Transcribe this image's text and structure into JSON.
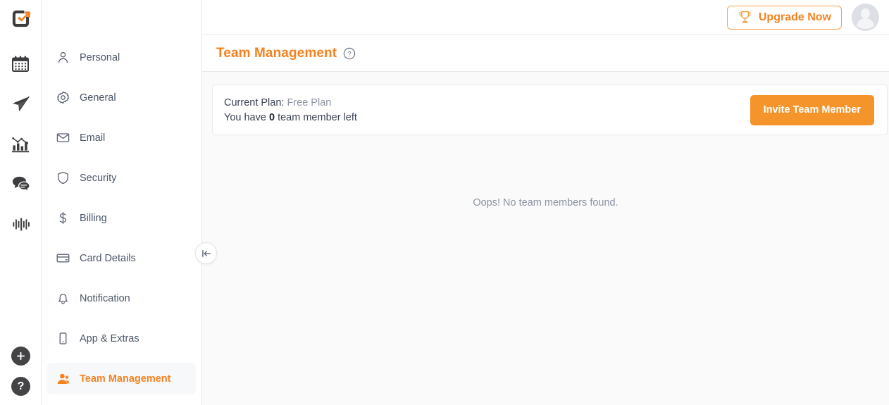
{
  "brand": {
    "logo_icon": "checkbox-arrow-logo",
    "accent_color": "#f5821f",
    "button_orange": "#f5942a"
  },
  "rail": {
    "items": [
      {
        "icon": "calendar-icon",
        "name": "calendar"
      },
      {
        "icon": "paper-plane-icon",
        "name": "send"
      },
      {
        "icon": "bar-chart-icon",
        "name": "analytics"
      },
      {
        "icon": "chat-bubbles-icon",
        "name": "messages"
      },
      {
        "icon": "audio-waveform-icon",
        "name": "voice"
      }
    ],
    "bottom": [
      {
        "icon": "plus-icon",
        "label": "+",
        "name": "add"
      },
      {
        "icon": "question-mark-icon",
        "label": "?",
        "name": "help"
      }
    ]
  },
  "topbar": {
    "upgrade_label": "Upgrade Now",
    "upgrade_icon": "trophy-icon",
    "avatar_icon": "user-avatar-placeholder"
  },
  "nav": {
    "items": [
      {
        "label": "Personal",
        "icon": "user-icon",
        "active": false
      },
      {
        "label": "General",
        "icon": "gear-icon",
        "active": false
      },
      {
        "label": "Email",
        "icon": "envelope-icon",
        "active": false
      },
      {
        "label": "Security",
        "icon": "shield-icon",
        "active": false
      },
      {
        "label": "Billing",
        "icon": "dollar-icon",
        "active": false
      },
      {
        "label": "Card Details",
        "icon": "credit-card-icon",
        "active": false
      },
      {
        "label": "Notification",
        "icon": "bell-icon",
        "active": false
      },
      {
        "label": "App & Extras",
        "icon": "mobile-icon",
        "active": false
      },
      {
        "label": "Team Management",
        "icon": "people-icon",
        "active": true
      }
    ],
    "collapse_icon": "collapse-left-icon"
  },
  "page": {
    "title": "Team Management",
    "help_icon": "question-circle-icon"
  },
  "plan": {
    "current_plan_label": "Current Plan:",
    "current_plan_value": "Free Plan",
    "seats_prefix": "You have",
    "seats_count": "0",
    "seats_suffix": "team member left",
    "invite_label": "Invite Team Member"
  },
  "empty": {
    "message": "Oops! No team members found."
  }
}
